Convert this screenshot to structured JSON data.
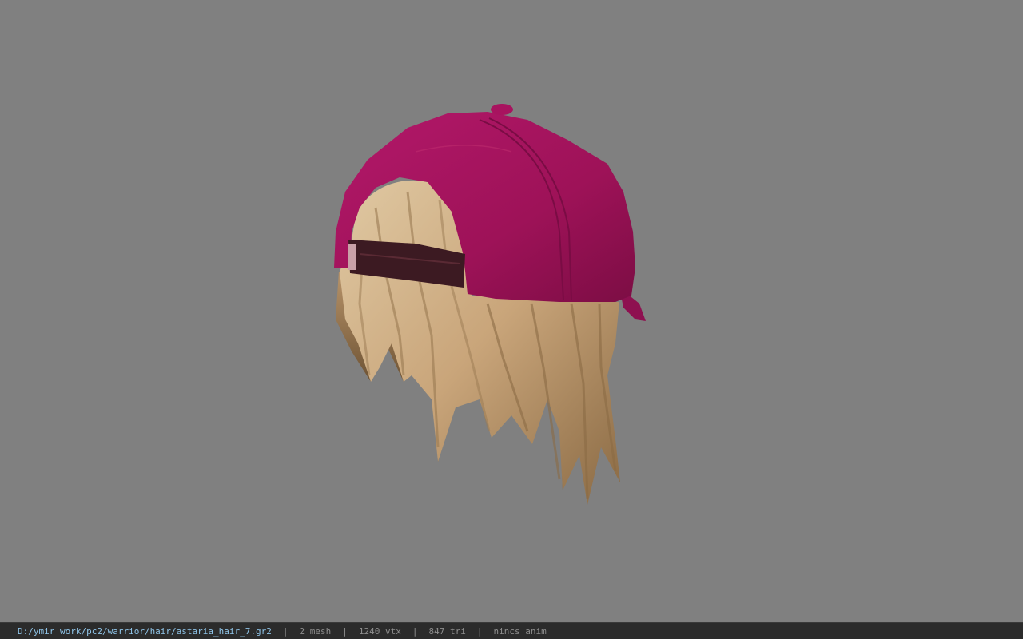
{
  "viewer": {
    "background_color": "#808080",
    "model": {
      "cap_color": "#a8135f",
      "hair_color": "#c9a57a",
      "strap_color": "#3c1a22"
    }
  },
  "status_bar": {
    "file_path": "D:/ymir work/pc2/warrior/hair/astaria_hair_7.gr2",
    "separator": "|",
    "mesh_count": "2 mesh",
    "vertex_count": "1240 vtx",
    "triangle_count": "847 tri",
    "anim_status": "nincs anim"
  }
}
